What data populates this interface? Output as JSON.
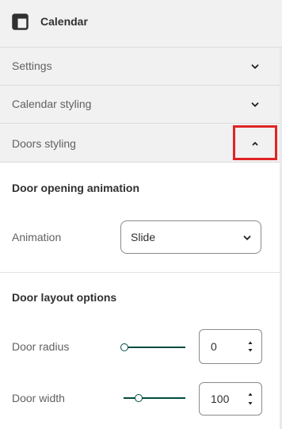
{
  "header": {
    "title": "Calendar",
    "icon": "layout-icon"
  },
  "sections": [
    {
      "label": "Settings",
      "state": "collapsed"
    },
    {
      "label": "Calendar styling",
      "state": "collapsed"
    },
    {
      "label": "Doors styling",
      "state": "expanded"
    }
  ],
  "door_opening": {
    "title": "Door opening animation",
    "animation_label": "Animation",
    "animation_value": "Slide"
  },
  "door_layout": {
    "title": "Door layout options",
    "radius_label": "Door radius",
    "radius_value": "0",
    "radius_fraction": 0.0,
    "width_label": "Door width",
    "width_value": "100",
    "width_fraction": 0.25
  },
  "colors": {
    "accent": "#004c3f",
    "highlight": "#e02424",
    "panel": "#f1f1f1"
  }
}
